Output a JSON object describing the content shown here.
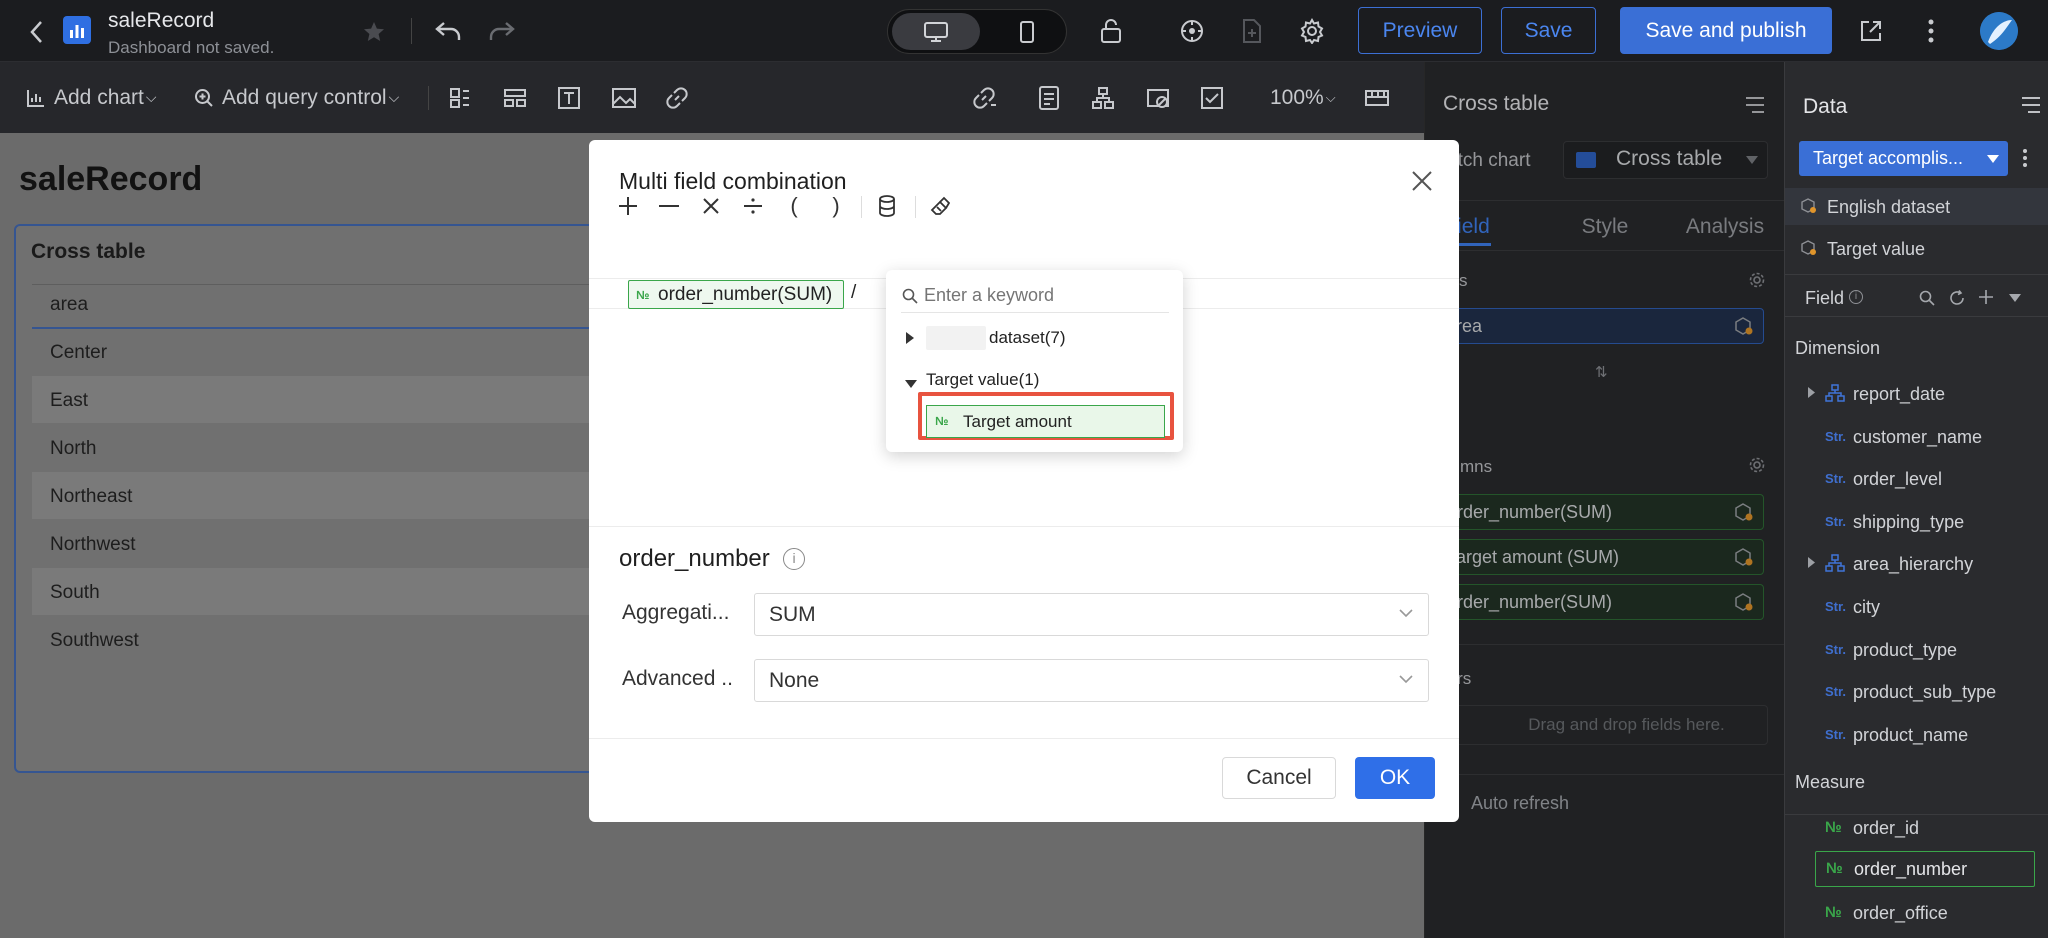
{
  "header": {
    "title": "saleRecord",
    "subtitle": "Dashboard not saved.",
    "preview_label": "Preview",
    "save_label": "Save",
    "save_publish_label": "Save and publish"
  },
  "toolbar": {
    "add_chart": "Add chart",
    "add_query_control": "Add query control",
    "zoom": "100%"
  },
  "canvas": {
    "title": "saleRecord",
    "card_title": "Cross table",
    "column_header": "area",
    "rows": [
      "Center",
      "East",
      "North",
      "Northeast",
      "Northwest",
      "South",
      "Southwest"
    ]
  },
  "config_panel": {
    "title": "Cross table",
    "switch_chart_label": "Switch chart",
    "switch_chart_value": "Cross table",
    "tabs": [
      "Field",
      "Style",
      "Analysis"
    ],
    "rows_label": "Rows",
    "rows_field": "area",
    "columns_label": "Columns",
    "columns_fields": [
      "order_number(SUM)",
      "Target amount (SUM)",
      "order_number(SUM)"
    ],
    "filters_label": "Filters",
    "filters_placeholder": "Drag and drop fields here.",
    "auto_refresh": "Auto refresh"
  },
  "data_panel": {
    "title": "Data",
    "dataset_select": "Target accomplis...",
    "datasets": [
      "English dataset",
      "Target value"
    ],
    "field_label": "Field",
    "dimension_label": "Dimension",
    "dimensions": [
      {
        "type": "hier",
        "name": "report_date"
      },
      {
        "type": "Str.",
        "name": "customer_name"
      },
      {
        "type": "Str.",
        "name": "order_level"
      },
      {
        "type": "Str.",
        "name": "shipping_type"
      },
      {
        "type": "hier",
        "name": "area_hierarchy"
      },
      {
        "type": "Str.",
        "name": "city"
      },
      {
        "type": "Str.",
        "name": "product_type"
      },
      {
        "type": "Str.",
        "name": "product_sub_type"
      },
      {
        "type": "Str.",
        "name": "product_name"
      }
    ],
    "measure_label": "Measure",
    "measures": [
      "order_id",
      "order_number",
      "order_office"
    ]
  },
  "modal": {
    "title": "Multi field combination",
    "operators": [
      "+",
      "—",
      "×",
      "÷",
      "(",
      ")"
    ],
    "expr_field": "order_number(SUM)",
    "expr_op": "/",
    "search_placeholder": "Enter a keyword",
    "tree": {
      "dataset_node": "dataset(7)",
      "target_node": "Target value(1)",
      "target_child": "Target amount"
    },
    "field_name": "order_number",
    "aggregation_label": "Aggregati...",
    "aggregation_value": "SUM",
    "advanced_label": "Advanced ..",
    "advanced_value": "None",
    "cancel_label": "Cancel",
    "ok_label": "OK"
  },
  "colors": {
    "accent": "#3370e8",
    "measure_green": "#3aa64a",
    "highlight_red": "#e8533f"
  }
}
